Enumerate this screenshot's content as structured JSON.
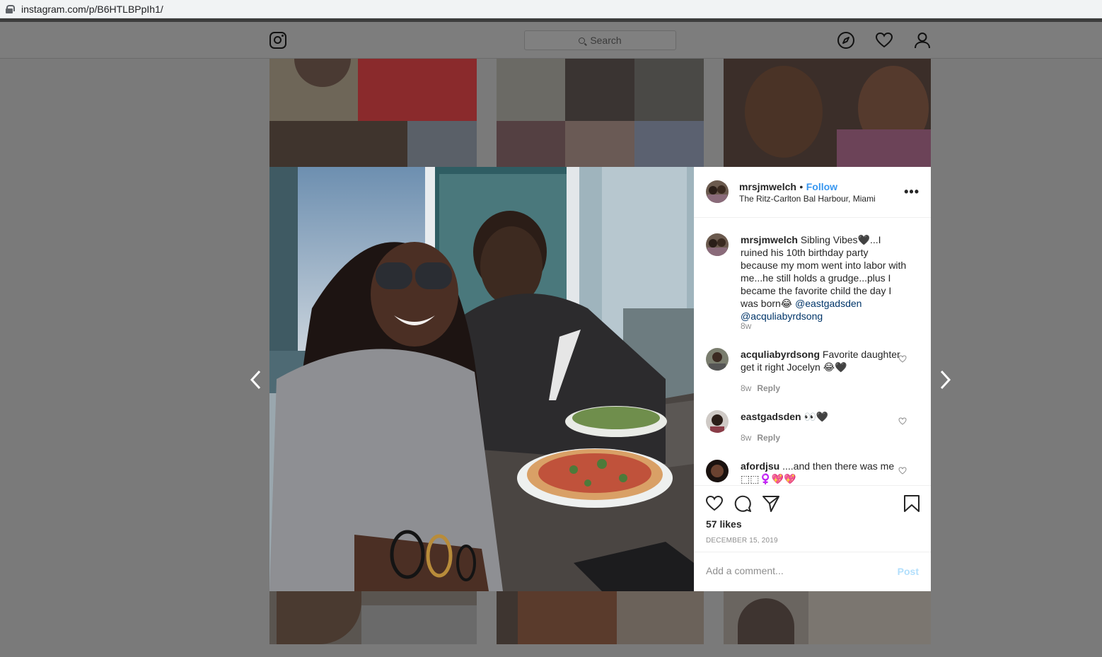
{
  "browser": {
    "url": "instagram.com/p/B6HTLBPpIh1/"
  },
  "header": {
    "search_placeholder": "Search"
  },
  "post": {
    "username": "mrsjmwelch",
    "separator": "•",
    "follow_label": "Follow",
    "location": "The Ritz-Carlton Bal Harbour, Miami",
    "more_label": "•••",
    "caption": {
      "username": "mrsjmwelch",
      "text": "Sibling Vibes🖤...I ruined his 10th birthday party because my mom went into labor with me...he still holds a grudge...plus I became the favorite child the day I was born😂",
      "mention1": "@eastgadsden",
      "mention2": "@acquliabyrdsong",
      "time": "8w"
    },
    "comments": [
      {
        "username": "acquliabyrdsong",
        "text": "Favorite daughter get it right Jocelyn 😂🖤",
        "time": "8w",
        "reply_label": "Reply"
      },
      {
        "username": "eastgadsden",
        "text": "👀🖤",
        "time": "8w",
        "reply_label": "Reply"
      },
      {
        "username": "afordjsu",
        "text": "....and then there was me ⬚⬚♀️💖💖"
      }
    ],
    "likes": "57 likes",
    "date": "DECEMBER 15, 2019",
    "comment_placeholder": "Add a comment...",
    "post_label": "Post"
  },
  "colors": {
    "link_blue": "#3897f0",
    "mention": "#003569",
    "muted": "#8e8e8e",
    "overlay": "#7a7a7a"
  },
  "icons": [
    "lock-icon",
    "instagram-logo-icon",
    "search-icon",
    "explore-compass-icon",
    "activity-heart-icon",
    "profile-icon",
    "more-options-icon",
    "like-heart-icon",
    "comment-icon",
    "share-icon",
    "bookmark-icon",
    "prev-arrow-icon",
    "next-arrow-icon"
  ]
}
